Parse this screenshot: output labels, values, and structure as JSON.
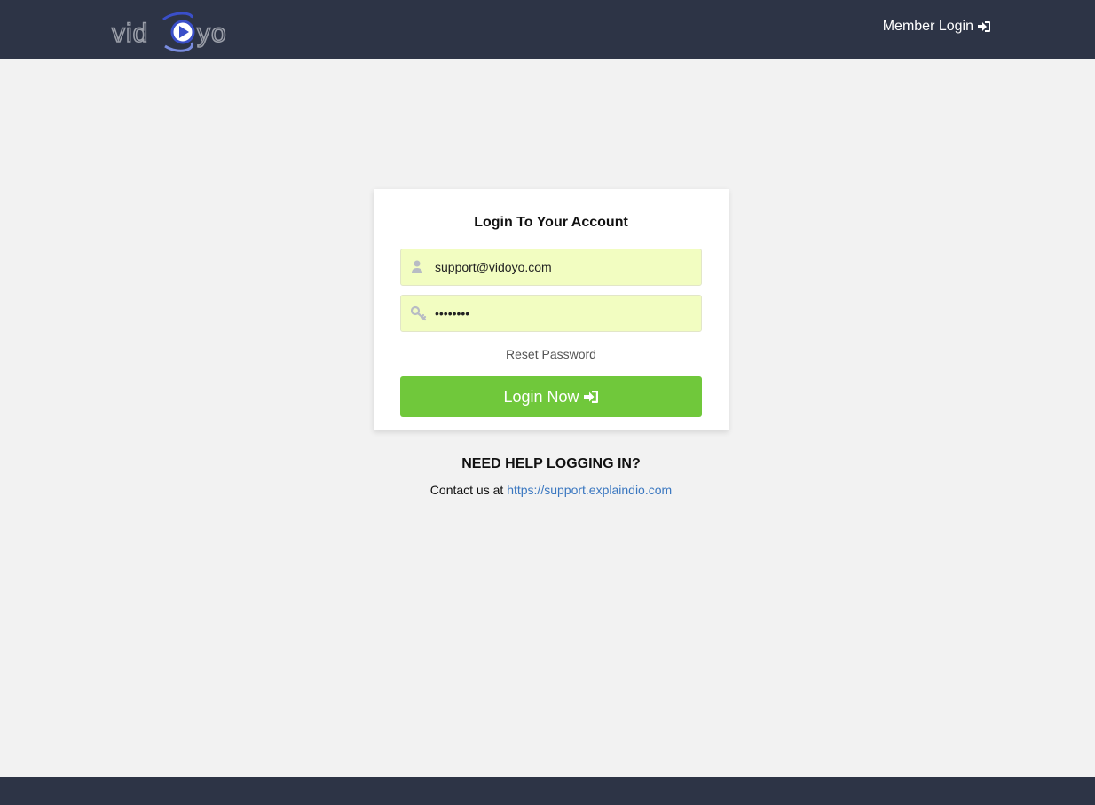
{
  "header": {
    "logo_text": "vidoyo",
    "member_login_label": "Member Login",
    "member_login_icon": "sign-in-icon",
    "background_color": "#2d3446"
  },
  "login_card": {
    "title": "Login To Your Account",
    "email": {
      "icon": "user-icon",
      "value": "support@vidoyo.com",
      "placeholder": ""
    },
    "password": {
      "icon": "key-icon",
      "value": "••••••••",
      "placeholder": ""
    },
    "reset_password_label": "Reset Password",
    "login_button_label": "Login Now",
    "login_button_icon": "sign-in-icon",
    "login_button_color": "#70c83b",
    "field_background_color": "#f2fdc1"
  },
  "help": {
    "title": "NEED HELP LOGGING IN?",
    "contact_prefix": "Contact us at",
    "support_url": "https://support.explaindio.com",
    "link_color": "#3a77c0"
  },
  "footer": {
    "background_color": "#2d3446"
  }
}
